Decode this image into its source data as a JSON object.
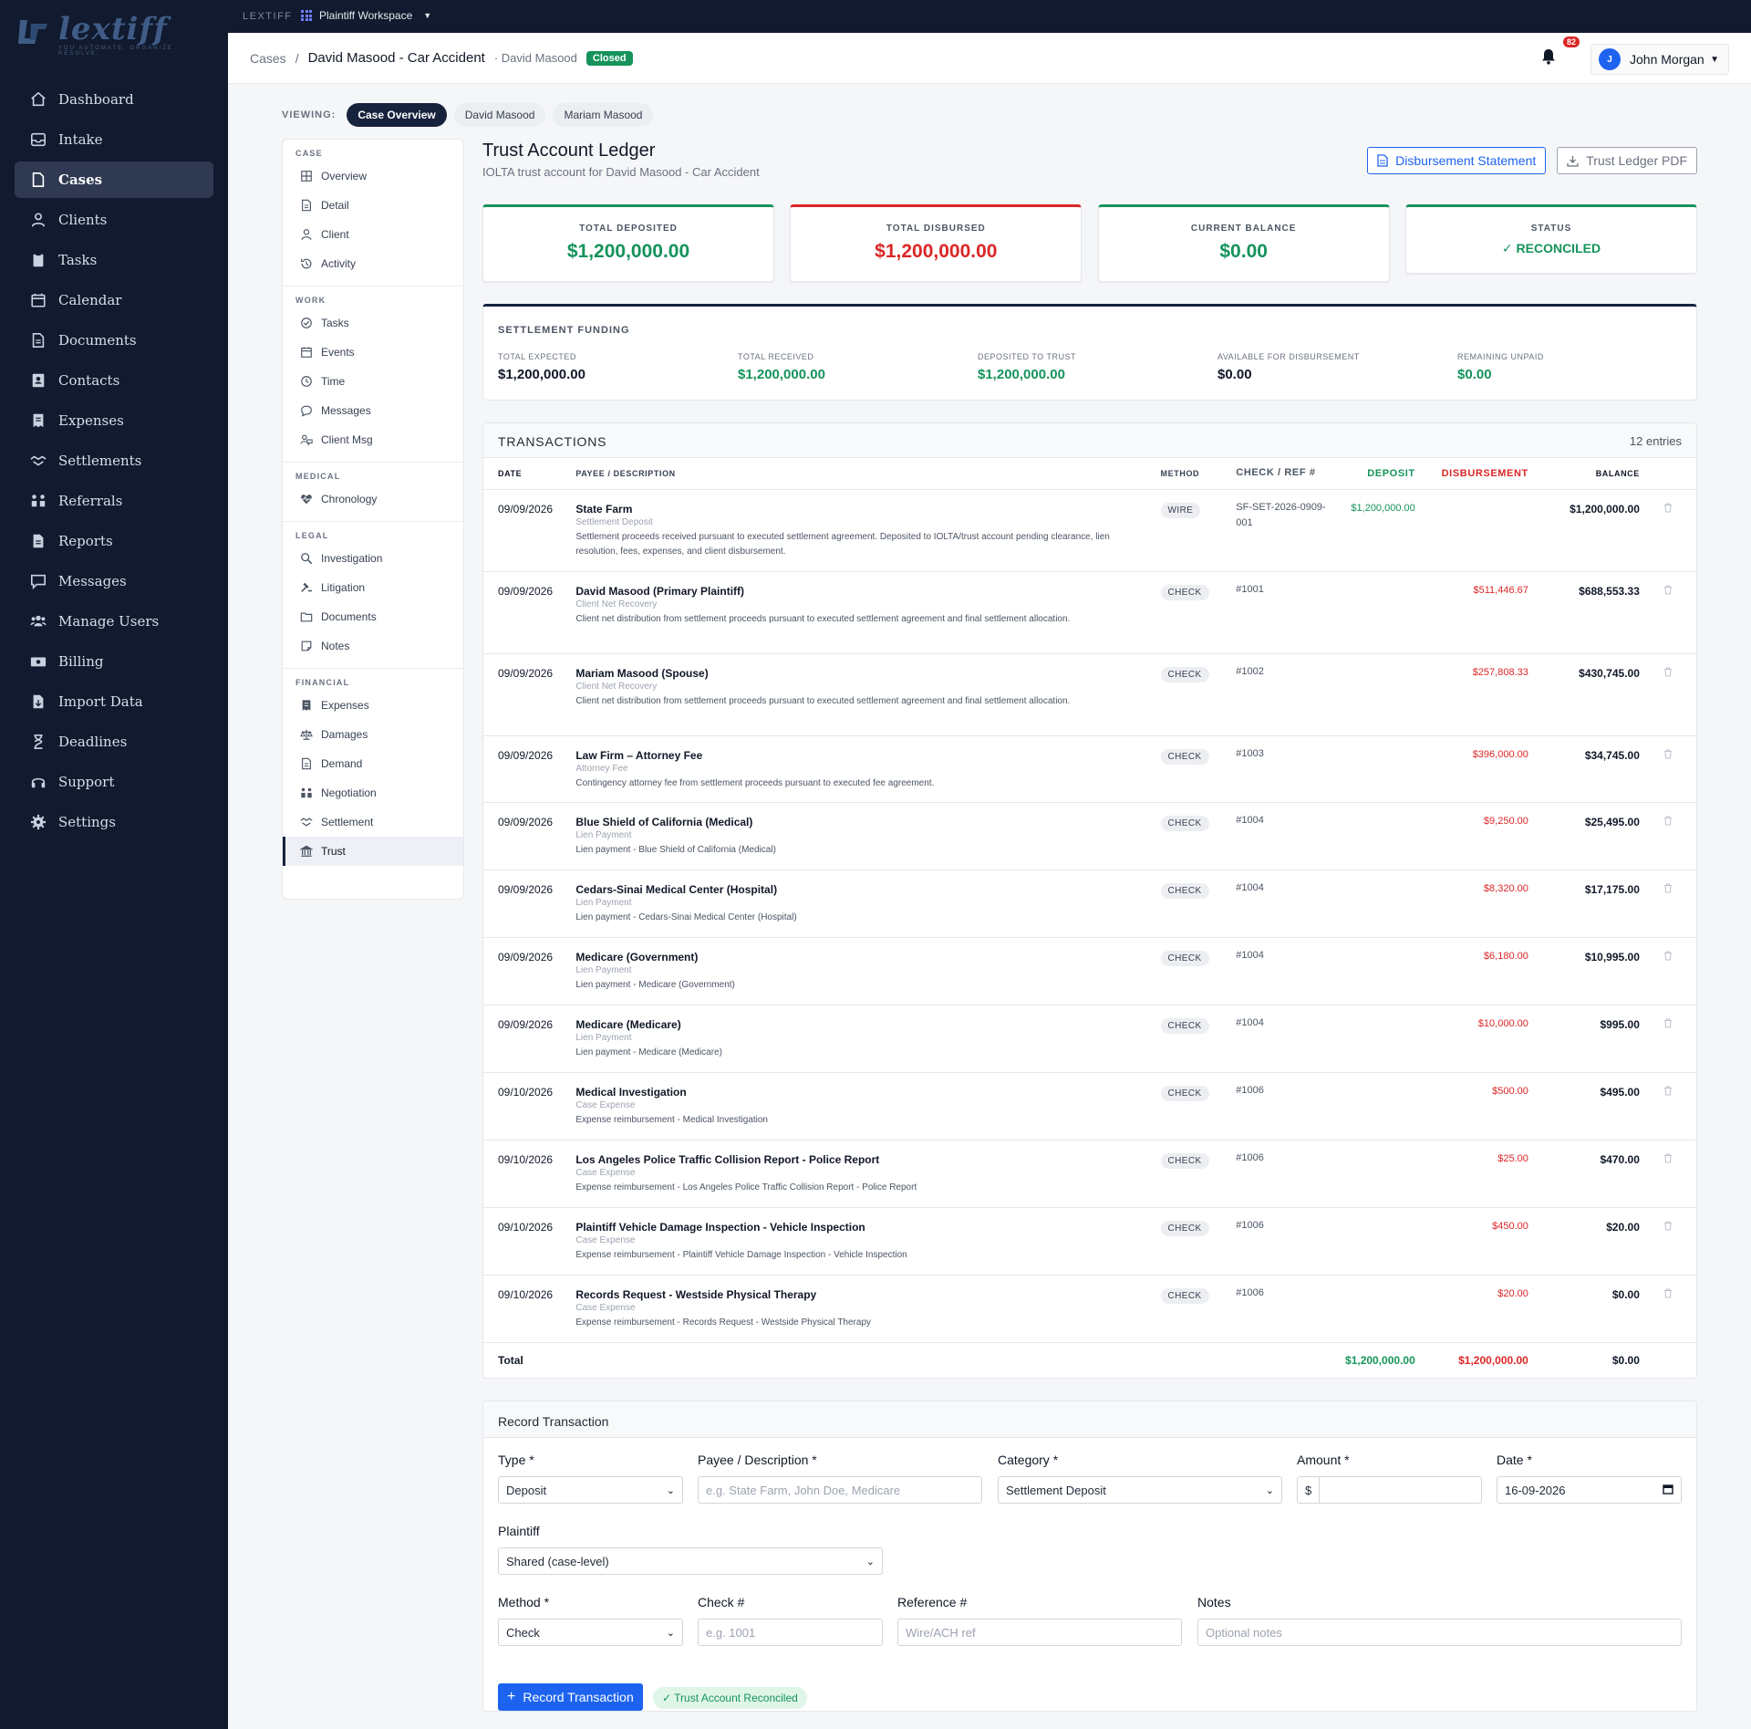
{
  "app": {
    "logo_text": "lextiff",
    "logo_tagline": "YOU AUTOMATE. ORGANIZE. RESOLVE."
  },
  "sidebar": {
    "items": [
      {
        "label": "Dashboard",
        "icon": "home-icon"
      },
      {
        "label": "Intake",
        "icon": "inbox-icon"
      },
      {
        "label": "Cases",
        "icon": "file-icon"
      },
      {
        "label": "Clients",
        "icon": "user-icon"
      },
      {
        "label": "Tasks",
        "icon": "clipboard-icon"
      },
      {
        "label": "Calendar",
        "icon": "calendar-icon"
      },
      {
        "label": "Documents",
        "icon": "document-icon"
      },
      {
        "label": "Contacts",
        "icon": "address-book-icon"
      },
      {
        "label": "Expenses",
        "icon": "receipt-icon"
      },
      {
        "label": "Settlements",
        "icon": "handshake-icon"
      },
      {
        "label": "Referrals",
        "icon": "people-arrows-icon"
      },
      {
        "label": "Reports",
        "icon": "report-icon"
      },
      {
        "label": "Messages",
        "icon": "message-icon"
      },
      {
        "label": "Manage Users",
        "icon": "users-icon"
      },
      {
        "label": "Billing",
        "icon": "money-icon"
      },
      {
        "label": "Import Data",
        "icon": "import-icon"
      },
      {
        "label": "Deadlines",
        "icon": "hourglass-icon"
      },
      {
        "label": "Support",
        "icon": "headset-icon"
      },
      {
        "label": "Settings",
        "icon": "gear-icon"
      }
    ],
    "active": "Cases"
  },
  "topbar": {
    "brand": "LEXTIFF",
    "workspace": "Plaintiff Workspace"
  },
  "header": {
    "crumb_root": "Cases",
    "crumb_sep": "/",
    "case_name": "David Masood - Car Accident",
    "client_sub": "· David Masood",
    "status_badge": "Closed",
    "notification_count": "82",
    "user_initial": "J",
    "user_name": "John Morgan"
  },
  "viewing": {
    "label": "VIEWING:",
    "pills": [
      "Case Overview",
      "David Masood",
      "Mariam Masood"
    ],
    "active": "Case Overview"
  },
  "subnav": {
    "sections": [
      {
        "title": "CASE",
        "items": [
          {
            "label": "Overview",
            "icon": "grid-icon"
          },
          {
            "label": "Detail",
            "icon": "document-icon"
          },
          {
            "label": "Client",
            "icon": "user-icon"
          },
          {
            "label": "Activity",
            "icon": "history-icon"
          }
        ]
      },
      {
        "title": "WORK",
        "items": [
          {
            "label": "Tasks",
            "icon": "check-circle-icon"
          },
          {
            "label": "Events",
            "icon": "calendar-icon"
          },
          {
            "label": "Time",
            "icon": "clock-icon"
          },
          {
            "label": "Messages",
            "icon": "chat-icon"
          },
          {
            "label": "Client Msg",
            "icon": "client-message-icon"
          }
        ]
      },
      {
        "title": "MEDICAL",
        "items": [
          {
            "label": "Chronology",
            "icon": "heartbeat-icon"
          }
        ]
      },
      {
        "title": "LEGAL",
        "items": [
          {
            "label": "Investigation",
            "icon": "search-icon"
          },
          {
            "label": "Litigation",
            "icon": "gavel-icon"
          },
          {
            "label": "Documents",
            "icon": "folder-icon"
          },
          {
            "label": "Notes",
            "icon": "note-icon"
          }
        ]
      },
      {
        "title": "FINANCIAL",
        "items": [
          {
            "label": "Expenses",
            "icon": "receipt-icon"
          },
          {
            "label": "Damages",
            "icon": "scale-icon"
          },
          {
            "label": "Demand",
            "icon": "document-icon"
          },
          {
            "label": "Negotiation",
            "icon": "people-arrows-icon"
          },
          {
            "label": "Settlement",
            "icon": "handshake-icon"
          },
          {
            "label": "Trust",
            "icon": "bank-icon"
          }
        ]
      }
    ],
    "active": "Trust"
  },
  "page": {
    "title": "Trust Account Ledger",
    "subtitle": "IOLTA trust account for David Masood - Car Accident",
    "btn_disbursement": "Disbursement Statement",
    "btn_trust_pdf": "Trust Ledger PDF"
  },
  "summary_cards": [
    {
      "label": "TOTAL DEPOSITED",
      "value": "$1,200,000.00",
      "color": "#15935b"
    },
    {
      "label": "TOTAL DISBURSED",
      "value": "$1,200,000.00",
      "color": "#dc2626"
    },
    {
      "label": "CURRENT BALANCE",
      "value": "$0.00",
      "color": "#15935b"
    },
    {
      "label": "STATUS",
      "value": "✓ RECONCILED",
      "color": "#15935b"
    }
  ],
  "funding": {
    "title": "SETTLEMENT FUNDING",
    "cols": [
      {
        "label": "TOTAL EXPECTED",
        "value": "$1,200,000.00",
        "color": "#111827"
      },
      {
        "label": "TOTAL RECEIVED",
        "value": "$1,200,000.00",
        "color": "#15935b"
      },
      {
        "label": "DEPOSITED TO TRUST",
        "value": "$1,200,000.00",
        "color": "#15935b"
      },
      {
        "label": "AVAILABLE FOR DISBURSEMENT",
        "value": "$0.00",
        "color": "#111827"
      },
      {
        "label": "REMAINING UNPAID",
        "value": "$0.00",
        "color": "#15935b"
      }
    ]
  },
  "transactions": {
    "title": "TRANSACTIONS",
    "count": "12 entries",
    "columns": [
      "DATE",
      "PAYEE / DESCRIPTION",
      "METHOD",
      "CHECK / REF #",
      "DEPOSIT",
      "DISBURSEMENT",
      "BALANCE"
    ],
    "rows": [
      {
        "date": "09/09/2026",
        "payee": "State Farm",
        "category": "Settlement Deposit",
        "desc": "Settlement proceeds received pursuant to executed settlement agreement. Deposited to IOLTA/trust account pending clearance, lien resolution, fees, expenses, and client disbursement.",
        "method": "WIRE",
        "ref": "SF-SET-2026-0909-001",
        "deposit": "$1,200,000.00",
        "disbursement": "",
        "balance": "$1,200,000.00"
      },
      {
        "date": "09/09/2026",
        "payee": "David Masood (Primary Plaintiff)",
        "category": "Client Net Recovery",
        "desc": "Client net distribution from settlement proceeds pursuant to executed settlement agreement and final settlement allocation.",
        "method": "CHECK",
        "ref": "#1001",
        "deposit": "",
        "disbursement": "$511,446.67",
        "balance": "$688,553.33"
      },
      {
        "date": "09/09/2026",
        "payee": "Mariam Masood (Spouse)",
        "category": "Client Net Recovery",
        "desc": "Client net distribution from settlement proceeds pursuant to executed settlement agreement and final settlement allocation.",
        "method": "CHECK",
        "ref": "#1002",
        "deposit": "",
        "disbursement": "$257,808.33",
        "balance": "$430,745.00"
      },
      {
        "date": "09/09/2026",
        "payee": "Law Firm – Attorney Fee",
        "category": "Attorney Fee",
        "desc": "Contingency attorney fee from settlement proceeds pursuant to executed fee agreement.",
        "method": "CHECK",
        "ref": "#1003",
        "deposit": "",
        "disbursement": "$396,000.00",
        "balance": "$34,745.00"
      },
      {
        "date": "09/09/2026",
        "payee": "Blue Shield of California (Medical)",
        "category": "Lien Payment",
        "desc": "Lien payment - Blue Shield of California (Medical)",
        "method": "CHECK",
        "ref": "#1004",
        "deposit": "",
        "disbursement": "$9,250.00",
        "balance": "$25,495.00"
      },
      {
        "date": "09/09/2026",
        "payee": "Cedars-Sinai Medical Center (Hospital)",
        "category": "Lien Payment",
        "desc": "Lien payment - Cedars-Sinai Medical Center (Hospital)",
        "method": "CHECK",
        "ref": "#1004",
        "deposit": "",
        "disbursement": "$8,320.00",
        "balance": "$17,175.00"
      },
      {
        "date": "09/09/2026",
        "payee": "Medicare (Government)",
        "category": "Lien Payment",
        "desc": "Lien payment - Medicare (Government)",
        "method": "CHECK",
        "ref": "#1004",
        "deposit": "",
        "disbursement": "$6,180.00",
        "balance": "$10,995.00"
      },
      {
        "date": "09/09/2026",
        "payee": "Medicare (Medicare)",
        "category": "Lien Payment",
        "desc": "Lien payment - Medicare (Medicare)",
        "method": "CHECK",
        "ref": "#1004",
        "deposit": "",
        "disbursement": "$10,000.00",
        "balance": "$995.00"
      },
      {
        "date": "09/10/2026",
        "payee": "Medical Investigation",
        "category": "Case Expense",
        "desc": "Expense reimbursement - Medical Investigation",
        "method": "CHECK",
        "ref": "#1006",
        "deposit": "",
        "disbursement": "$500.00",
        "balance": "$495.00"
      },
      {
        "date": "09/10/2026",
        "payee": "Los Angeles Police Traffic Collision Report - Police Report",
        "category": "Case Expense",
        "desc": "Expense reimbursement - Los Angeles Police Traffic Collision Report - Police Report",
        "method": "CHECK",
        "ref": "#1006",
        "deposit": "",
        "disbursement": "$25.00",
        "balance": "$470.00"
      },
      {
        "date": "09/10/2026",
        "payee": "Plaintiff Vehicle Damage Inspection - Vehicle Inspection",
        "category": "Case Expense",
        "desc": "Expense reimbursement - Plaintiff Vehicle Damage Inspection - Vehicle Inspection",
        "method": "CHECK",
        "ref": "#1006",
        "deposit": "",
        "disbursement": "$450.00",
        "balance": "$20.00"
      },
      {
        "date": "09/10/2026",
        "payee": "Records Request - Westside Physical Therapy",
        "category": "Case Expense",
        "desc": "Expense reimbursement - Records Request - Westside Physical Therapy",
        "method": "CHECK",
        "ref": "#1006",
        "deposit": "",
        "disbursement": "$20.00",
        "balance": "$0.00"
      }
    ],
    "total": {
      "label": "Total",
      "deposit": "$1,200,000.00",
      "disbursement": "$1,200,000.00",
      "balance": "$0.00"
    }
  },
  "record_form": {
    "title": "Record Transaction",
    "type": {
      "label": "Type *",
      "value": "Deposit"
    },
    "payee": {
      "label": "Payee / Description *",
      "placeholder": "e.g. State Farm, John Doe, Medicare"
    },
    "category": {
      "label": "Category *",
      "value": "Settlement Deposit"
    },
    "amount": {
      "label": "Amount *",
      "prefix": "$",
      "value": ""
    },
    "date": {
      "label": "Date *",
      "value": "16-09-2026"
    },
    "plaintiff": {
      "label": "Plaintiff",
      "value": "Shared (case-level)"
    },
    "method": {
      "label": "Method *",
      "value": "Check"
    },
    "check": {
      "label": "Check #",
      "placeholder": "e.g. 1001"
    },
    "reference": {
      "label": "Reference #",
      "placeholder": "Wire/ACH ref"
    },
    "notes": {
      "label": "Notes",
      "placeholder": "Optional notes"
    },
    "submit": "Record Transaction",
    "reconciled_chip": "✓ Trust Account Reconciled"
  }
}
